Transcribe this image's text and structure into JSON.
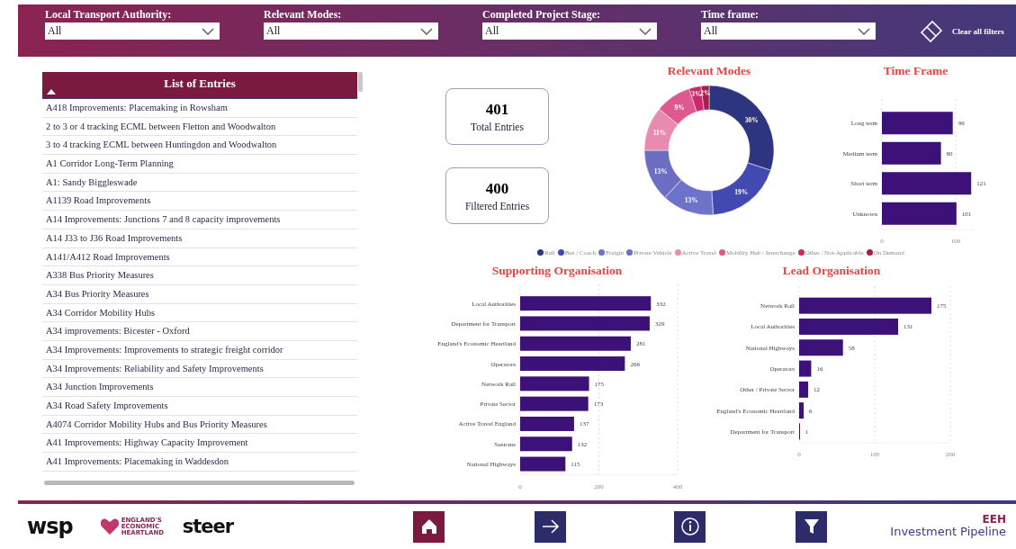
{
  "filters": [
    {
      "label": "Local Transport Authority:",
      "value": "All"
    },
    {
      "label": "Relevant Modes:",
      "value": "All"
    },
    {
      "label": "Completed Project Stage:",
      "value": "All"
    },
    {
      "label": "Time frame:",
      "value": "All"
    }
  ],
  "clear_filters": {
    "label": "Clear all filters"
  },
  "entries": {
    "title": "List of Entries",
    "items": [
      "A418 Improvements: Placemaking in Rowsham",
      "2 to 3 or 4 tracking ECML between Fletton and Woodwalton",
      "3 to 4 tracking ECML between Huntingdon and Woodwalton",
      "A1 Corridor Long-Term Planning",
      "A1: Sandy Biggleswade",
      "A1139 Road Improvements",
      "A14 Improvements: Junctions 7 and 8 capacity improvements",
      "A14 J33 to J36 Road Improvements",
      "A141/A412 Road Improvements",
      "A338 Bus Priority Measures",
      "A34 Bus Priority Measures",
      "A34 Corridor Mobility Hubs",
      "A34 improvements: Bicester - Oxford",
      "A34 Improvements: Improvements to strategic freight corridor",
      "A34 Improvements: Reliability and Safety Improvements",
      "A34 Junction Improvements",
      "A34 Road Safety Improvements",
      "A4074 Corridor Mobility Hubs and Bus Priority Measures",
      "A41 Improvements: Highway Capacity Improvement",
      "A41 Improvements: Placemaking in Waddesdon"
    ]
  },
  "stats": [
    {
      "value": "401",
      "label": "Total Entries"
    },
    {
      "value": "400",
      "label": "Filtered Entries"
    }
  ],
  "relevant_modes": {
    "chart_data": {
      "type": "donut",
      "title": "Relevant Modes",
      "categories": [
        "Rail",
        "Bus / Coach",
        "Freight",
        "Private Vehicle",
        "Active Travel",
        "Mobility Hub / Interchange",
        "Other / Not-Applicable",
        "On Demand"
      ],
      "values": [
        30,
        19,
        13,
        13,
        11,
        9,
        3,
        2
      ],
      "colors": [
        "#2e3580",
        "#4249b0",
        "#6e72c9",
        "#6c6ec2",
        "#e88bb0",
        "#dd5990",
        "#cf2868",
        "#a61e4f"
      ],
      "value_labels": [
        "30%",
        "19%",
        "13%",
        "13%",
        "11%",
        "9%",
        "3%",
        "2%"
      ]
    }
  },
  "time_frame": {
    "chart_data": {
      "type": "bar",
      "orientation": "horizontal",
      "title": "Time Frame",
      "categories": [
        "Long term",
        "Medium term",
        "Short term",
        "Unknown"
      ],
      "values": [
        96,
        80,
        121,
        101
      ],
      "xlim": [
        0,
        125
      ],
      "xticks": [
        0,
        100
      ],
      "data_labels": true
    }
  },
  "supporting_organisation": {
    "chart_data": {
      "type": "bar",
      "orientation": "horizontal",
      "title": "Supporting Organisation",
      "categories": [
        "Local Authorities",
        "Department for Transport",
        "England's Economic Heartland",
        "Operators",
        "Network Rail",
        "Private Sector",
        "Active Travel England",
        "Sustrans",
        "National Highways"
      ],
      "values": [
        332,
        329,
        281,
        266,
        175,
        173,
        137,
        132,
        115
      ],
      "xlim": [
        0,
        400
      ],
      "xticks": [
        0,
        200,
        400
      ],
      "data_labels": true
    }
  },
  "lead_organisation": {
    "chart_data": {
      "type": "bar",
      "orientation": "horizontal",
      "title": "Lead Organisation",
      "categories": [
        "Network Rail",
        "Local Authorities",
        "National Highways",
        "Operators",
        "Other / Private Sector",
        "England's Economic Heartland",
        "Department for Transport"
      ],
      "values": [
        175,
        131,
        58,
        16,
        12,
        6,
        1
      ],
      "xlim": [
        0,
        200
      ],
      "xticks": [
        0,
        100,
        200
      ],
      "data_labels": true
    }
  },
  "footer": {
    "logos": [
      "wsp",
      "ENGLAND'S ECONOMIC HEARTLAND",
      "steer"
    ],
    "nav": [
      {
        "kind": "home"
      },
      {
        "kind": "next"
      },
      {
        "kind": "info"
      },
      {
        "kind": "filter"
      }
    ],
    "brand": {
      "mark": "EEH",
      "name": "Investment Pipeline"
    }
  }
}
